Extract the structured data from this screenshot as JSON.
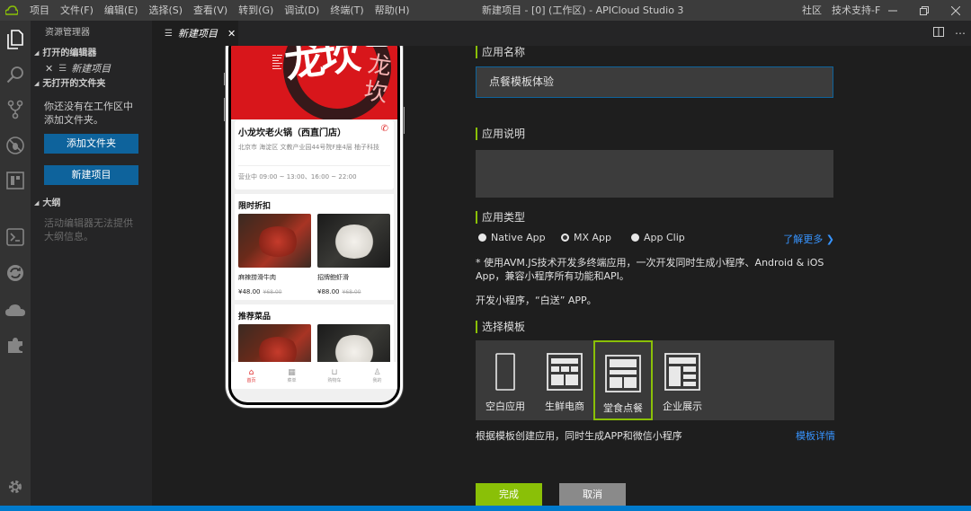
{
  "window": {
    "menu": [
      "项目",
      "文件(F)",
      "编辑(E)",
      "选择(S)",
      "查看(V)",
      "转到(G)",
      "调试(D)",
      "终端(T)",
      "帮助(H)"
    ],
    "title": "新建项目 - [0] (工作区) - APICloud Studio 3",
    "right_links": [
      "社区",
      "技术支持-F"
    ]
  },
  "sidebar": {
    "title": "资源管理器",
    "open_editors_label": "打开的编辑器",
    "open_file": "新建项目",
    "no_folder_label": "无打开的文件夹",
    "no_folder_message": "你还没有在工作区中添加文件夹。",
    "add_folder_button": "添加文件夹",
    "new_project_button": "新建项目",
    "outline_label": "大纲",
    "outline_message": "活动编辑器无法提供大纲信息。"
  },
  "editor_tab": {
    "label": "新建项目"
  },
  "phone_preview": {
    "hero_text": "龙坎",
    "hero_side_text": "龙坎",
    "store_name": "小龙坎老火锅（西直门店）",
    "store_address": "北京市 海淀区 文教产业园44号院F座4层 柚子科技",
    "store_hours": "营业中 09:00 ~ 13:00、16:00 ~ 22:00",
    "section_discount": "限时折扣",
    "dishes": [
      {
        "name": "麻辣捞滑牛肉",
        "price": "¥48.00",
        "old_price": "¥68.00"
      },
      {
        "name": "招牌鲍虾滑",
        "price": "¥88.00",
        "old_price": "¥68.00"
      }
    ],
    "section_recommend": "推荐菜品",
    "tabs": [
      "首页",
      "菜单",
      "购物车",
      "我的"
    ]
  },
  "form": {
    "app_name_label": "应用名称",
    "app_name_value": "点餐模板体验",
    "app_desc_label": "应用说明",
    "app_desc_value": "",
    "app_type_label": "应用类型",
    "app_types": [
      "Native App",
      "MX App",
      "App Clip"
    ],
    "app_type_selected": "MX App",
    "learn_more": "了解更多 ❯",
    "note_1": "* 使用AVM.JS技术开发多终端应用，一次开发同时生成小程序、Android & iOS App，兼容小程序所有功能和API。",
    "note_2": "开发小程序，“白送” APP。",
    "template_label": "选择模板",
    "templates": [
      "空白应用",
      "生鲜电商",
      "堂食点餐",
      "企业展示"
    ],
    "template_selected": "堂食点餐",
    "template_footer": "根据模板创建应用，同时生成APP和微信小程序",
    "template_detail": "模板详情",
    "done_button": "完成",
    "cancel_button": "取消"
  },
  "colors": {
    "accent_green": "#8ac007",
    "link_blue": "#3794ff",
    "button_blue": "#0e639c",
    "status_blue": "#007acc"
  }
}
